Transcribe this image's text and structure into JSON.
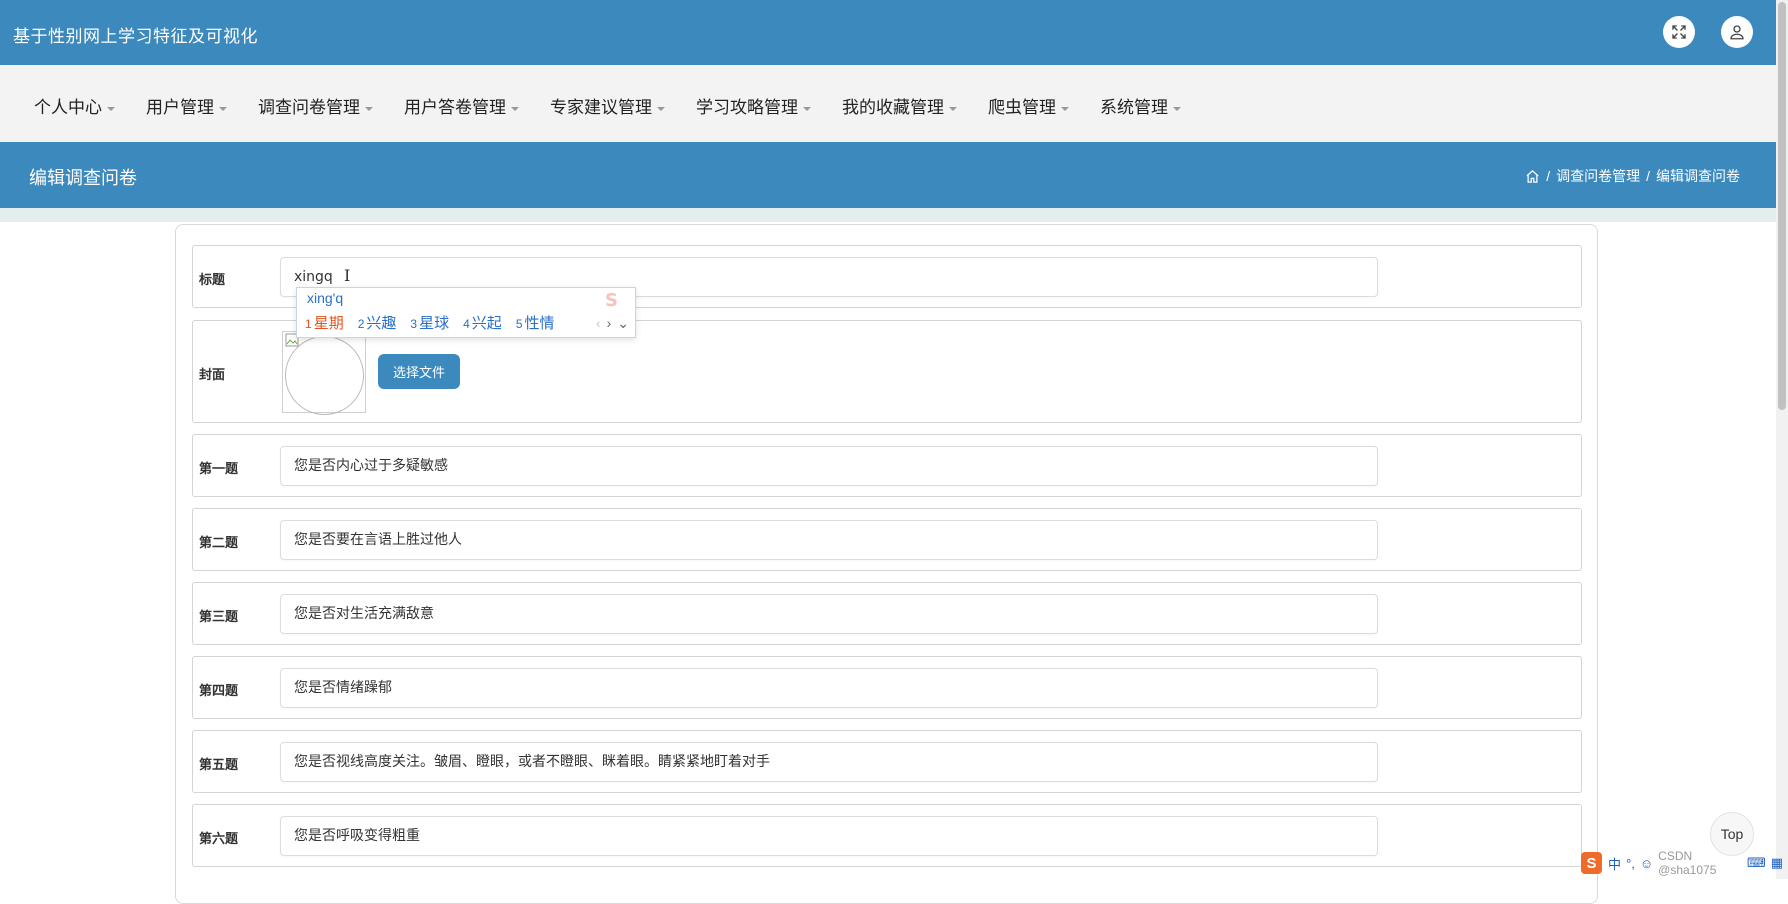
{
  "header": {
    "app_title": "基于性别网上学习特征及可视化"
  },
  "menu": [
    {
      "label": "个人中心"
    },
    {
      "label": "用户管理"
    },
    {
      "label": "调查问卷管理"
    },
    {
      "label": "用户答卷管理"
    },
    {
      "label": "专家建议管理"
    },
    {
      "label": "学习攻略管理"
    },
    {
      "label": "我的收藏管理"
    },
    {
      "label": "爬虫管理"
    },
    {
      "label": "系统管理"
    }
  ],
  "page": {
    "title": "编辑调查问卷",
    "breadcrumb": [
      "调查问卷管理",
      "编辑调查问卷"
    ]
  },
  "form": {
    "title_label": "标题",
    "title_value": "xingq",
    "cover_label": "封面",
    "choose_file_label": "选择文件",
    "questions": [
      {
        "label": "第一题",
        "value": "您是否内心过于多疑敏感"
      },
      {
        "label": "第二题",
        "value": "您是否要在言语上胜过他人"
      },
      {
        "label": "第三题",
        "value": "您是否对生活充满敌意"
      },
      {
        "label": "第四题",
        "value": "您是否情绪躁郁"
      },
      {
        "label": "第五题",
        "value": "您是否视线高度关注。皱眉、瞪眼，或者不瞪眼、眯着眼。睛紧紧地盯着对手"
      },
      {
        "label": "第六题",
        "value": "您是否呼吸变得粗重"
      }
    ]
  },
  "ime": {
    "composition": "xing'q",
    "candidates": [
      {
        "num": "1",
        "text": "星期"
      },
      {
        "num": "2",
        "text": "兴趣"
      },
      {
        "num": "3",
        "text": "星球"
      },
      {
        "num": "4",
        "text": "兴起"
      },
      {
        "num": "5",
        "text": "性情"
      }
    ]
  },
  "top_button": "Top",
  "tray": {
    "ime_lang": "中",
    "watermark": "CSDN @sha1075"
  },
  "colors": {
    "primary": "#3c89bd",
    "menu_bg": "#f3f3f3",
    "band": "#e4eeec",
    "ime_active": "#e5541f",
    "ime_text": "#2a6fc9"
  }
}
